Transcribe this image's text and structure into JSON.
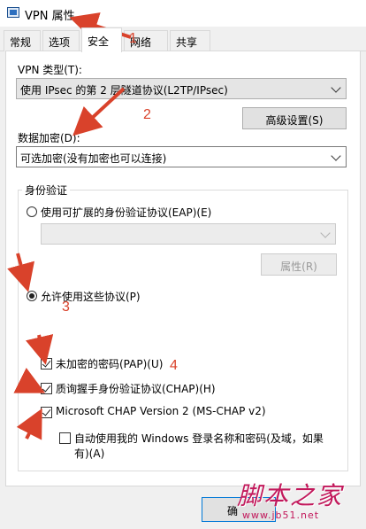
{
  "window": {
    "title": "VPN 属性"
  },
  "tabs": [
    {
      "label": "常规"
    },
    {
      "label": "选项"
    },
    {
      "label": "安全"
    },
    {
      "label": "网络"
    },
    {
      "label": "共享"
    }
  ],
  "vpn_type": {
    "label": "VPN 类型(T):",
    "value": "使用 IPsec 的第 2 层隧道协议(L2TP/IPsec)",
    "advanced_button": "高级设置(S)"
  },
  "encryption": {
    "label": "数据加密(D):",
    "value": "可选加密(没有加密也可以连接)"
  },
  "auth": {
    "group_title": "身份验证",
    "eap_option": "使用可扩展的身份验证协议(EAP)(E)",
    "eap_select_value": "",
    "properties_button": "属性(R)",
    "allow_protocols_option": "允许使用这些协议(P)",
    "protocols": [
      {
        "label": "未加密的密码(PAP)(U)",
        "checked": true
      },
      {
        "label": "质询握手身份验证协议(CHAP)(H)",
        "checked": true
      },
      {
        "label": "Microsoft CHAP Version 2 (MS-CHAP v2)",
        "checked": true
      }
    ],
    "auto_logon_line1": "自动使用我的 Windows 登录名称和密码(及域，如果",
    "auto_logon_line2": "有)(A)",
    "auto_logon_checked": false
  },
  "annotations": {
    "n1": "1",
    "n2": "2",
    "n3": "3",
    "n4": "4",
    "color": "#d9422b"
  },
  "bottom": {
    "ok_button": "确"
  },
  "watermark": {
    "text": "脚本之家",
    "url": "www.jb51.net"
  }
}
